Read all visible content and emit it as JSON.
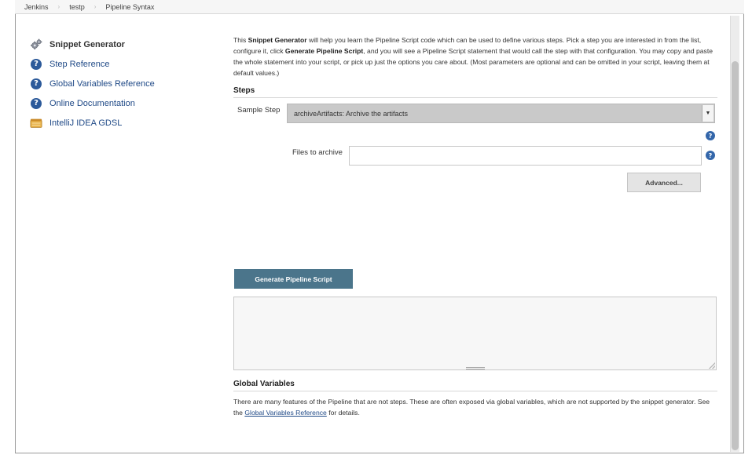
{
  "breadcrumb": {
    "items": [
      {
        "label": "Jenkins"
      },
      {
        "label": "testp"
      },
      {
        "label": "Pipeline Syntax"
      }
    ],
    "separator": "›"
  },
  "sidebar": {
    "items": [
      {
        "label": "Snippet Generator",
        "icon": "gears-icon",
        "active": true
      },
      {
        "label": "Step Reference",
        "icon": "help-icon"
      },
      {
        "label": "Global Variables Reference",
        "icon": "help-icon"
      },
      {
        "label": "Online Documentation",
        "icon": "help-icon"
      },
      {
        "label": "IntelliJ IDEA GDSL",
        "icon": "notepad-icon"
      }
    ]
  },
  "intro": {
    "p1": "This ",
    "b1": "Snippet Generator",
    "p2": " will help you learn the Pipeline Script code which can be used to define various steps. Pick a step you are interested in from the list, configure it, click ",
    "b2": "Generate Pipeline Script",
    "p3": ", and you will see a Pipeline Script statement that would call the step with that configuration. You may copy and paste the whole statement into your script, or pick up just the options you care about. (Most parameters are optional and can be omitted in your script, leaving them at default values.)"
  },
  "steps": {
    "title": "Steps",
    "sample_step_label": "Sample Step",
    "sample_step_value": "archiveArtifacts: Archive the artifacts",
    "files_label": "Files to archive",
    "files_value": "",
    "advanced_label": "Advanced...",
    "help_glyph": "?"
  },
  "generate": {
    "label": "Generate Pipeline Script",
    "output": ""
  },
  "global_variables": {
    "title": "Global Variables",
    "text1": "There are many features of the Pipeline that are not steps. These are often exposed via global variables, which are not supported by the snippet generator. See the ",
    "link": "Global Variables Reference",
    "text2": " for details."
  },
  "colors": {
    "link": "#204a87",
    "generate_button": "#4b758b",
    "select_bg": "#c9c9c9"
  }
}
